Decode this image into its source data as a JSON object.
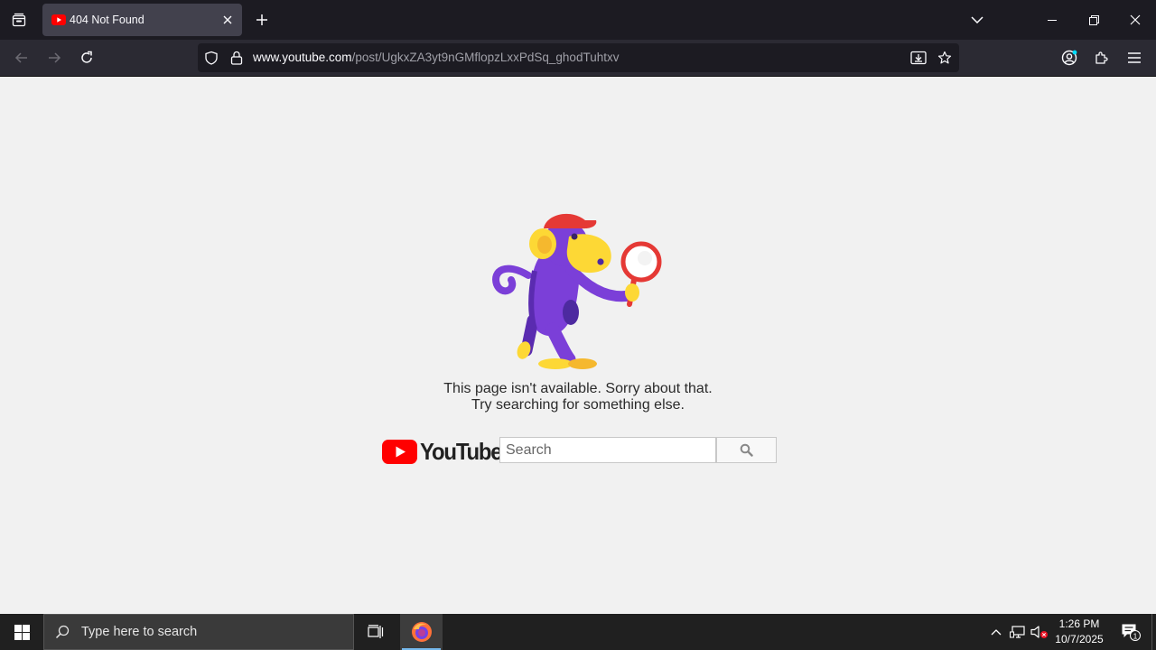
{
  "browser": {
    "tab": {
      "title": "404 Not Found",
      "favicon": "youtube-icon"
    },
    "url": {
      "host": "www.youtube.com",
      "path": "/post/UgkxZA3yt9nGMflopzLxxPdSq_ghodTuhtxv"
    }
  },
  "page": {
    "message_line1": "This page isn't available. Sorry about that.",
    "message_line2": "Try searching for something else.",
    "logo_text": "YouTube",
    "search_placeholder": "Search"
  },
  "taskbar": {
    "search_placeholder": "Type here to search",
    "time": "1:26 PM",
    "date": "10/7/2025",
    "notification_count": "1"
  },
  "colors": {
    "youtube_red": "#ff0000",
    "monkey_purple": "#7b3fd8",
    "monkey_yellow": "#fdd835",
    "cap_red": "#e53935"
  }
}
